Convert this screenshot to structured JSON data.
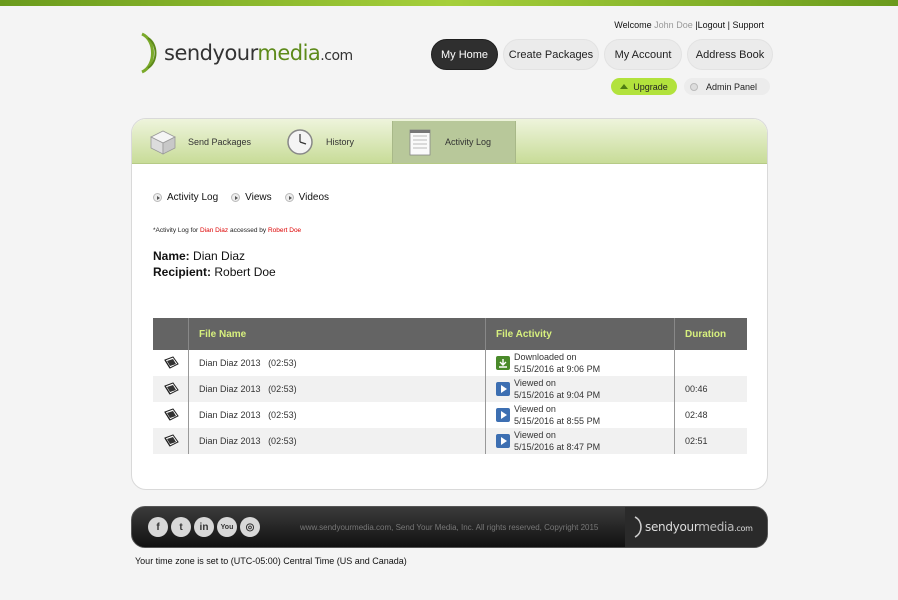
{
  "brand": {
    "name_send": "send",
    "name_your": "your",
    "name_media": "media",
    "name_com": ".com",
    "accent": "#5d8a1a",
    "highlight": "#b2e23c"
  },
  "header": {
    "welcome_label": "Welcome",
    "user_name": "John Doe",
    "logout": "Logout",
    "support": "Support",
    "sep": "|"
  },
  "nav": {
    "home": "My Home",
    "create": "Create Packages",
    "account": "My Account",
    "address": "Address Book",
    "upgrade": "Upgrade",
    "admin": "Admin Panel"
  },
  "tabs": [
    {
      "label": "Send Packages",
      "icon": "box-icon"
    },
    {
      "label": "History",
      "icon": "clock-icon"
    },
    {
      "label": "Activity Log",
      "icon": "notepad-icon"
    }
  ],
  "sublinks": [
    "Activity Log",
    "Views",
    "Videos"
  ],
  "note": {
    "prefix": "*Activity Log for",
    "name": "Dian Diaz",
    "mid": "accessed by",
    "recipient": "Robert Doe"
  },
  "info": {
    "name_label": "Name:",
    "name_value": "Dian Diaz",
    "recipient_label": "Recipient:",
    "recipient_value": "Robert Doe"
  },
  "table": {
    "headers": [
      "File Name",
      "File Activity",
      "Duration"
    ],
    "rows": [
      {
        "file": "Dian Diaz 2013",
        "length": "(02:53)",
        "action": "Downloaded on",
        "date": "5/15/2016 at 9:06 PM",
        "duration": "",
        "icon": "download-icon"
      },
      {
        "file": "Dian Diaz 2013",
        "length": "(02:53)",
        "action": "Viewed on",
        "date": "5/15/2016 at 9:04 PM",
        "duration": "00:46",
        "icon": "play-icon"
      },
      {
        "file": "Dian Diaz 2013",
        "length": "(02:53)",
        "action": "Viewed on",
        "date": "5/15/2016 at 8:55 PM",
        "duration": "02:48",
        "icon": "play-icon"
      },
      {
        "file": "Dian Diaz 2013",
        "length": "(02:53)",
        "action": "Viewed on",
        "date": "5/15/2016 at 8:47 PM",
        "duration": "02:51",
        "icon": "play-icon"
      }
    ]
  },
  "footer": {
    "social": [
      {
        "glyph": "f",
        "icon": "facebook-icon"
      },
      {
        "glyph": "t",
        "icon": "twitter-icon"
      },
      {
        "glyph": "in",
        "icon": "linkedin-icon"
      },
      {
        "glyph": "You",
        "icon": "youtube-icon"
      },
      {
        "glyph": "◎",
        "icon": "rss-icon"
      }
    ],
    "copyright": "www.sendyourmedia.com, Send Your Media, Inc. All rights reserved, Copyright 2015",
    "timezone": "Your time zone is set to (UTC-05:00) Central Time (US and Canada)"
  }
}
